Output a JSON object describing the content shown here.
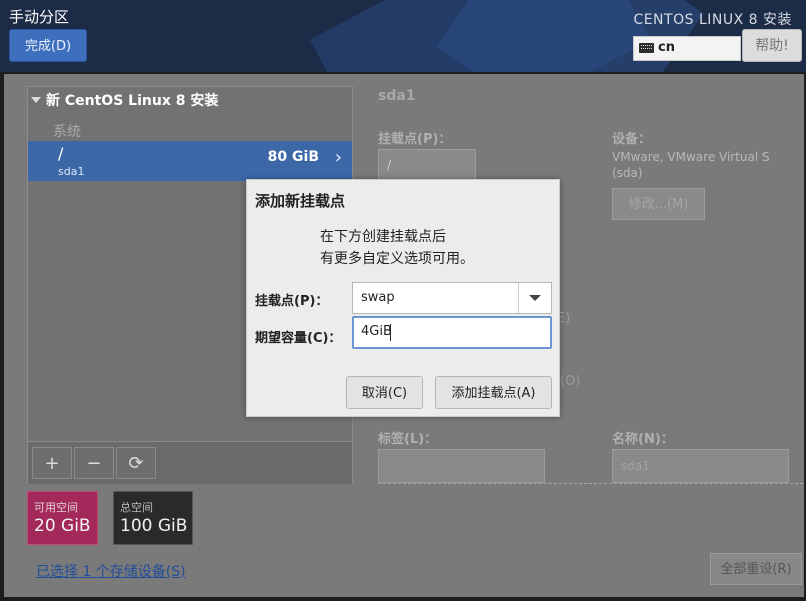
{
  "header": {
    "title": "手动分区",
    "done_label": "完成(D)",
    "product": "CENTOS LINUX 8 安装",
    "keyboard": "cn",
    "help_label": "帮助!"
  },
  "left_panel": {
    "title": "新 CentOS Linux 8 安装",
    "section": "系统",
    "rows": [
      {
        "mount": "/",
        "device": "sda1",
        "size": "80 GiB"
      }
    ],
    "toolbar": {
      "add": "+",
      "remove": "−",
      "refresh": "⟳"
    }
  },
  "space": {
    "available_label": "可用空间",
    "available_value": "20 GiB",
    "total_label": "总空间",
    "total_value": "100 GiB"
  },
  "storage_link": "已选择 1 个存储设备(S)",
  "reset_label": "全部重设(R)",
  "right_panel": {
    "title": "sda1",
    "mount_label": "挂载点(P)：",
    "mount_value": "/",
    "device_label": "设备：",
    "device_text": "VMware, VMware Virtual S",
    "device_sub": "(sda)",
    "edit_label": "修改...(M)",
    "frag_e": "E)",
    "frag_o": "(O)",
    "tag_label": "标签(L)：",
    "name_label": "名称(N)：",
    "name_placeholder": "sda1"
  },
  "dialog": {
    "title": "添加新挂载点",
    "desc_line1": "在下方创建挂载点后",
    "desc_line2": "有更多自定义选项可用。",
    "mount_label": "挂载点(P)：",
    "mount_value": "swap",
    "capacity_label": "期望容量(C)：",
    "capacity_value": "4GiB",
    "cancel_label": "取消(C)",
    "add_label": "添加挂载点(A)"
  }
}
